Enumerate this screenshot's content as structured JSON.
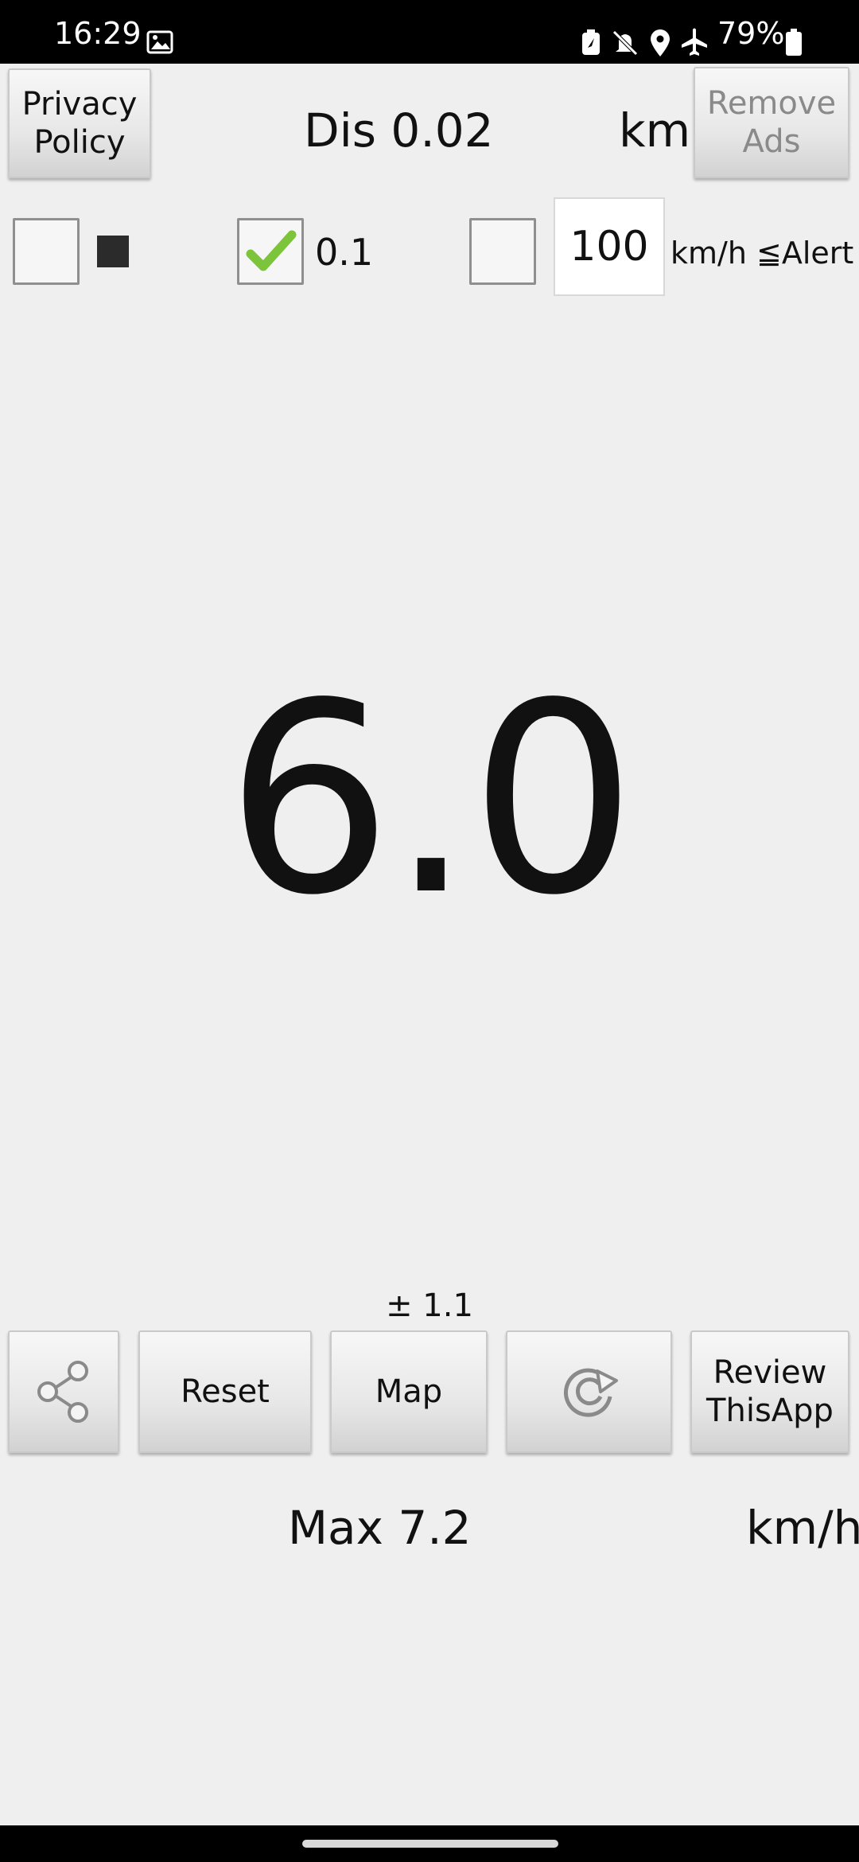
{
  "status_bar": {
    "time": "16:29",
    "battery": "79%",
    "icons": [
      "image-icon",
      "battery-saver-icon",
      "mute-icon",
      "location-icon",
      "airplane-icon",
      "battery-icon"
    ]
  },
  "header": {
    "privacy_label": "Privacy\nPolicy",
    "distance_text": "Dis 0.02",
    "distance_unit": "km",
    "remove_ads_label": "Remove\nAds"
  },
  "options": {
    "checkbox1_checked": false,
    "swatch_color": "#2b2b2b",
    "checkbox2_checked": true,
    "checkbox2_label": "0.1",
    "checkbox3_checked": false,
    "alert_speed_value": "100",
    "alert_label": "km/h ≦Alert"
  },
  "speed": {
    "current": "6.0",
    "accuracy": "± 1.1"
  },
  "toolbar": {
    "share_icon": "share-icon",
    "reset_label": "Reset",
    "map_label": "Map",
    "refresh_icon": "refresh-icon",
    "review_label": "Review\nThisApp"
  },
  "footer": {
    "max_text": "Max 7.2",
    "unit": "km/h"
  }
}
